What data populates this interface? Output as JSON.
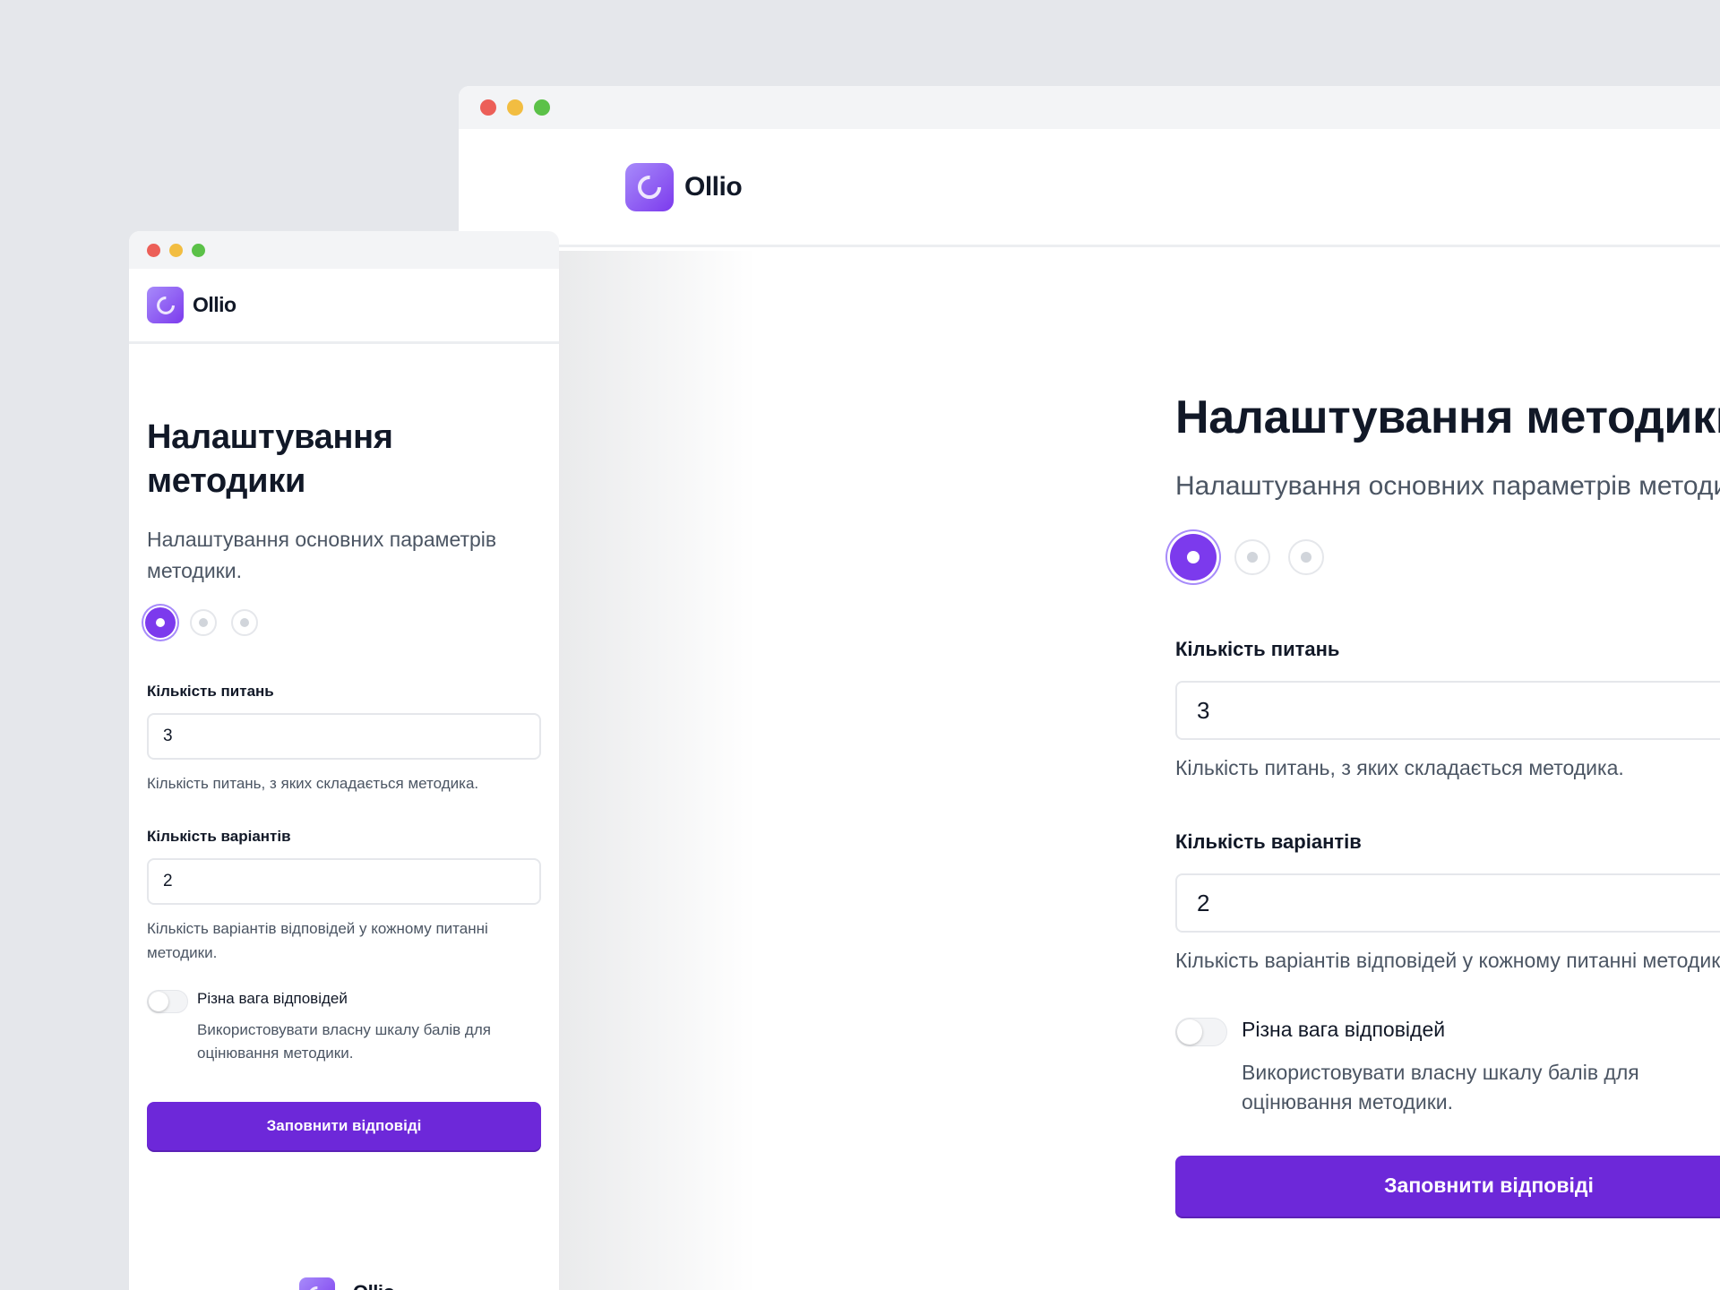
{
  "brand": {
    "name": "Ollio",
    "logo_icon": "ollio-ring-logo",
    "accent_color": "#7c3aed"
  },
  "page": {
    "title": "Налаштування методики",
    "subtitle": "Налаштування основних параметрів методики.",
    "steps": [
      {
        "state": "active"
      },
      {
        "state": "inactive"
      },
      {
        "state": "inactive"
      }
    ]
  },
  "fields": {
    "questions": {
      "label": "Кількість питань",
      "value": "3",
      "help": "Кількість питань, з яких складається методика."
    },
    "variants": {
      "label": "Кількість варіантів",
      "value": "2",
      "help": "Кількість варіантів відповідей у кожному питанні методики."
    }
  },
  "toggle": {
    "title": "Різна вага відповідей",
    "description": "Використовувати власну шкалу балів для оцінювання методики.",
    "enabled": false
  },
  "submit_label": "Заповнити відповіді",
  "window_controls": [
    "close",
    "minimize",
    "maximize"
  ]
}
